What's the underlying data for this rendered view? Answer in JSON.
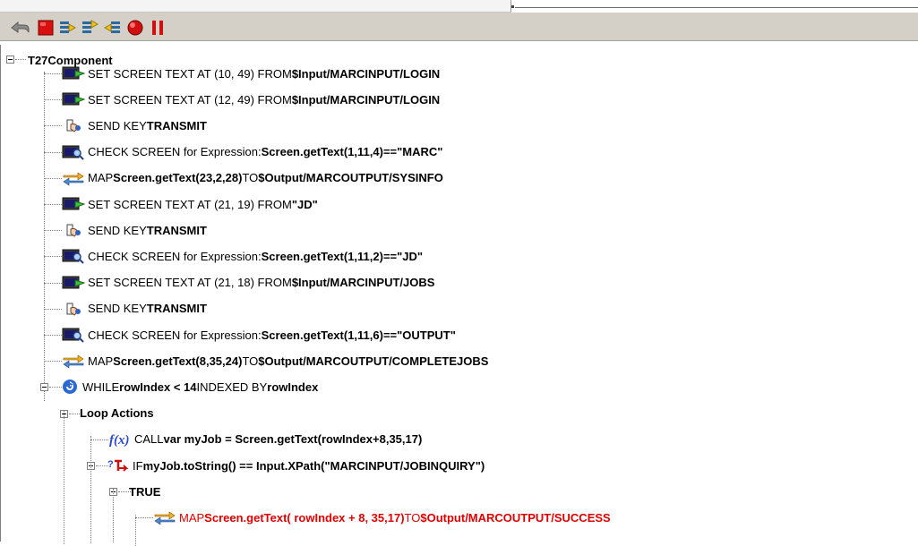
{
  "toolbar": {
    "buttons": [
      {
        "name": "back-icon"
      },
      {
        "name": "stop-icon"
      },
      {
        "name": "step-into-icon"
      },
      {
        "name": "step-over-icon"
      },
      {
        "name": "step-out-icon"
      },
      {
        "name": "record-icon"
      },
      {
        "name": "pause-icon"
      }
    ]
  },
  "tree": {
    "root": "T27Component",
    "rows": [
      {
        "kind": "set",
        "parts": [
          {
            "t": "SET SCREEN TEXT AT (10, 49) FROM "
          },
          {
            "t": "$Input/MARCINPUT/LOGIN",
            "b": true
          }
        ]
      },
      {
        "kind": "set",
        "parts": [
          {
            "t": "SET SCREEN TEXT AT (12, 49) FROM "
          },
          {
            "t": "$Input/MARCINPUT/LOGIN",
            "b": true
          }
        ]
      },
      {
        "kind": "key",
        "parts": [
          {
            "t": "SEND KEY "
          },
          {
            "t": "TRANSMIT",
            "b": true
          }
        ]
      },
      {
        "kind": "check",
        "parts": [
          {
            "t": "CHECK SCREEN for Expression: "
          },
          {
            "t": "Screen.getText(1,11,4)==\"MARC\"",
            "b": true
          }
        ]
      },
      {
        "kind": "map",
        "parts": [
          {
            "t": "MAP "
          },
          {
            "t": "Screen.getText(23,2,28)",
            "b": true
          },
          {
            "t": " TO "
          },
          {
            "t": "$Output/MARCOUTPUT/SYSINFO",
            "b": true
          }
        ]
      },
      {
        "kind": "set",
        "parts": [
          {
            "t": "SET SCREEN TEXT AT (21, 19) FROM "
          },
          {
            "t": "\"JD\"",
            "b": true
          }
        ]
      },
      {
        "kind": "key",
        "parts": [
          {
            "t": "SEND KEY "
          },
          {
            "t": "TRANSMIT",
            "b": true
          }
        ]
      },
      {
        "kind": "check",
        "parts": [
          {
            "t": "CHECK SCREEN for Expression: "
          },
          {
            "t": "Screen.getText(1,11,2)==\"JD\"",
            "b": true
          }
        ]
      },
      {
        "kind": "set",
        "parts": [
          {
            "t": "SET SCREEN TEXT AT (21, 18) FROM "
          },
          {
            "t": "$Input/MARCINPUT/JOBS",
            "b": true
          }
        ]
      },
      {
        "kind": "key",
        "parts": [
          {
            "t": "SEND KEY "
          },
          {
            "t": "TRANSMIT",
            "b": true
          }
        ]
      },
      {
        "kind": "check",
        "parts": [
          {
            "t": "CHECK SCREEN for Expression: "
          },
          {
            "t": "Screen.getText(1,11,6)==\"OUTPUT\"",
            "b": true
          }
        ]
      },
      {
        "kind": "map",
        "parts": [
          {
            "t": "MAP "
          },
          {
            "t": "Screen.getText(8,35,24)",
            "b": true
          },
          {
            "t": " TO "
          },
          {
            "t": "$Output/MARCOUTPUT/COMPLETEJOBS",
            "b": true
          }
        ]
      },
      {
        "kind": "while",
        "parts": [
          {
            "t": "WHILE "
          },
          {
            "t": "rowIndex < 14",
            "b": true
          },
          {
            "t": " INDEXED BY "
          },
          {
            "t": "rowIndex",
            "b": true
          }
        ]
      },
      {
        "kind": "group",
        "parts": [
          {
            "t": "Loop Actions",
            "b": true
          }
        ]
      },
      {
        "kind": "fx",
        "parts": [
          {
            "t": "CALL "
          },
          {
            "t": "var myJob = Screen.getText(rowIndex+8,35,17)",
            "b": true
          }
        ]
      },
      {
        "kind": "if",
        "parts": [
          {
            "t": "IF "
          },
          {
            "t": "myJob.toString() == Input.XPath(\"MARCINPUT/JOBINQUIRY\")",
            "b": true
          }
        ]
      },
      {
        "kind": "group",
        "parts": [
          {
            "t": "TRUE",
            "b": true
          }
        ]
      },
      {
        "kind": "map",
        "red": true,
        "parts": [
          {
            "t": "MAP "
          },
          {
            "t": "Screen.getText( rowIndex + 8, 35,17)",
            "b": true
          },
          {
            "t": " TO "
          },
          {
            "t": "$Output/MARCOUTPUT/SUCCESS",
            "b": true
          }
        ]
      }
    ]
  }
}
